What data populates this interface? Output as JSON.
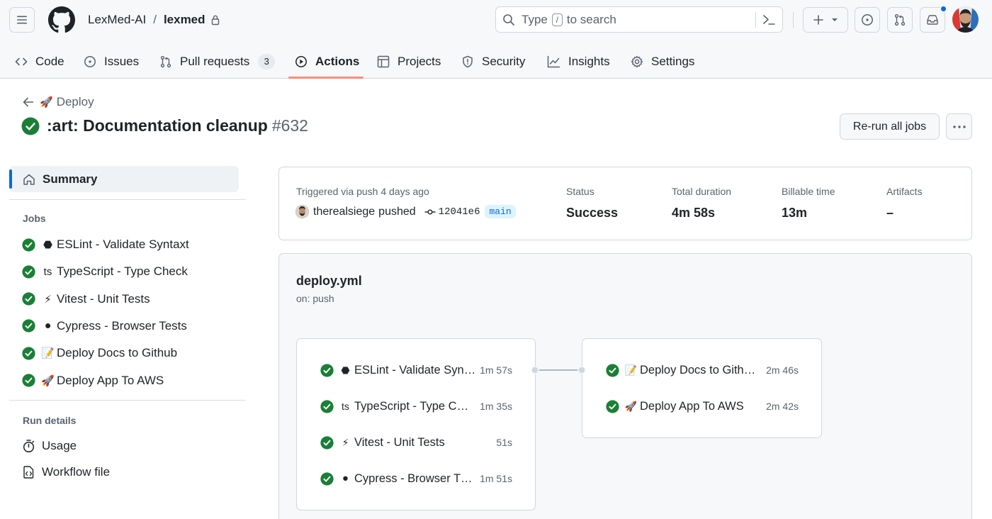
{
  "header": {
    "owner": "LexMed-AI",
    "separator": "/",
    "repo": "lexmed",
    "search_prefix": "Type",
    "search_key": "/",
    "search_suffix": "to search"
  },
  "repo_nav": {
    "code": "Code",
    "issues": "Issues",
    "pull_requests": "Pull requests",
    "pull_requests_count": "3",
    "actions": "Actions",
    "projects": "Projects",
    "security": "Security",
    "insights": "Insights",
    "settings": "Settings"
  },
  "run": {
    "back_emoji": "🚀",
    "back_label": "Deploy",
    "title": ":art: Documentation cleanup",
    "number": "#632",
    "rerun_label": "Re-run all jobs"
  },
  "sidebar": {
    "summary": "Summary",
    "jobs_heading": "Jobs",
    "jobs": [
      {
        "emoji": "⬣",
        "label": "ESLint - Validate Syntaxt"
      },
      {
        "emoji": "ts",
        "label": "TypeScript - Type Check"
      },
      {
        "emoji": "⚡",
        "label": "Vitest - Unit Tests"
      },
      {
        "emoji": "⚫",
        "label": "Cypress - Browser Tests"
      },
      {
        "emoji": "📝",
        "label": "Deploy Docs to Github"
      },
      {
        "emoji": "🚀",
        "label": "Deploy App To AWS"
      }
    ],
    "run_details_heading": "Run details",
    "usage": "Usage",
    "workflow_file": "Workflow file"
  },
  "summary_card": {
    "triggered": "Triggered via push 4 days ago",
    "actor": "therealsiege",
    "action": "pushed",
    "sha": "12041e6",
    "branch": "main",
    "status_label": "Status",
    "status_value": "Success",
    "duration_label": "Total duration",
    "duration_value": "4m 58s",
    "billable_label": "Billable time",
    "billable_value": "13m",
    "artifacts_label": "Artifacts",
    "artifacts_value": "–"
  },
  "graph": {
    "workflow_name": "deploy.yml",
    "trigger": "on: push",
    "stage1": [
      {
        "emoji": "⬣",
        "label": "ESLint - Validate Syn…",
        "duration": "1m 57s"
      },
      {
        "emoji": "ts",
        "label": "TypeScript - Type C…",
        "duration": "1m 35s"
      },
      {
        "emoji": "⚡",
        "label": "Vitest - Unit Tests",
        "duration": "51s"
      },
      {
        "emoji": "⚫",
        "label": "Cypress - Browser T…",
        "duration": "1m 51s"
      }
    ],
    "stage2": [
      {
        "emoji": "📝",
        "label": "Deploy Docs to Gith…",
        "duration": "2m 46s"
      },
      {
        "emoji": "🚀",
        "label": "Deploy App To AWS",
        "duration": "2m 42s"
      }
    ]
  },
  "colors": {
    "success": "#1a7f37",
    "accent": "#0969da",
    "nav_underline": "#fd8c73"
  }
}
